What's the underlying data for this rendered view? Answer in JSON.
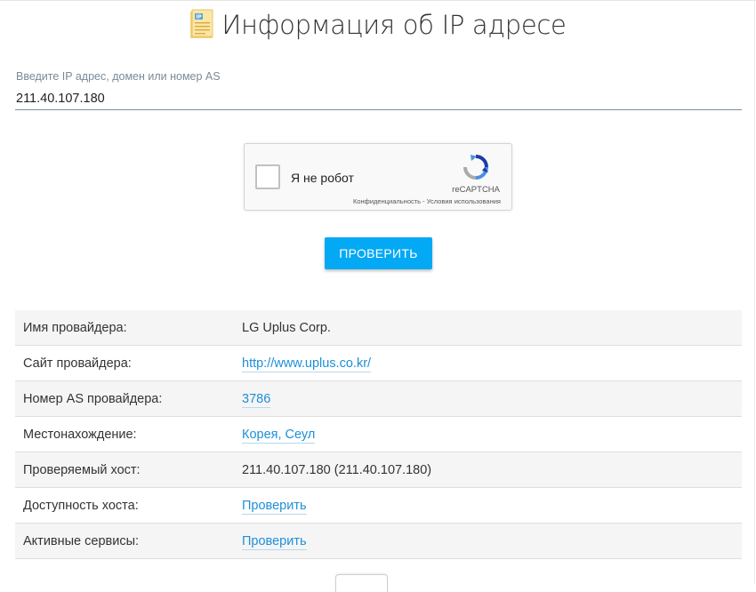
{
  "page": {
    "title": "Информация об IP адресе",
    "title_icon": "ip-document-icon",
    "icon_label": "IP"
  },
  "search": {
    "label": "Введите IP адрес, домен или номер AS",
    "value": "211.40.107.180"
  },
  "captcha": {
    "label": "Я не робот",
    "brand": "reCAPTCHA",
    "links": "Конфиденциальность - Условия использования",
    "checked": false
  },
  "actions": {
    "check_label": "ПРОВЕРИТЬ",
    "check_color": "#03a9f4"
  },
  "info": {
    "link_color": "#1d8fd8",
    "rows": [
      {
        "label": "Имя провайдера:",
        "value": "LG Uplus Corp.",
        "link": false
      },
      {
        "label": "Сайт провайдера:",
        "value": "http://www.uplus.co.kr/",
        "link": true
      },
      {
        "label": "Номер AS провайдера:",
        "value": "3786",
        "link": true
      },
      {
        "label": "Местонахождение:",
        "value": "Корея, Сеул",
        "link": true
      },
      {
        "label": "Проверяемый хост:",
        "value": "211.40.107.180 (211.40.107.180)",
        "link": false
      },
      {
        "label": "Доступность хоста:",
        "value": "Проверить",
        "link": true
      },
      {
        "label": "Активные сервисы:",
        "value": "Проверить",
        "link": true
      }
    ]
  }
}
